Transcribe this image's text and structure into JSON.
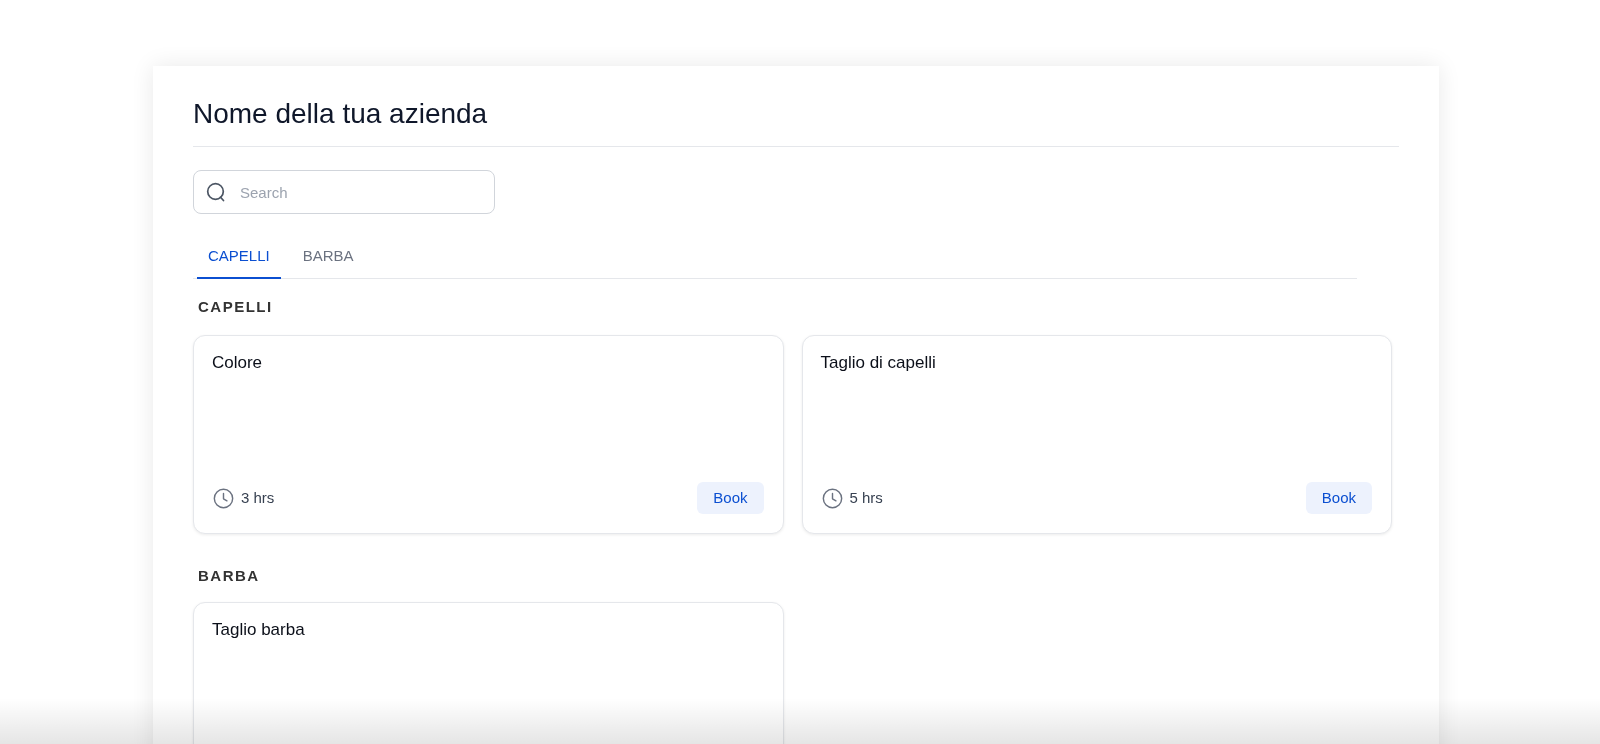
{
  "header": {
    "title": "Nome della tua azienda"
  },
  "search": {
    "placeholder": "Search"
  },
  "tabs": [
    {
      "label": "CAPELLI",
      "selected": true
    },
    {
      "label": "BARBA",
      "selected": false
    }
  ],
  "sections": [
    {
      "heading": "CAPELLI",
      "services": [
        {
          "name": "Colore",
          "duration": "3 hrs",
          "action": "Book"
        },
        {
          "name": "Taglio di capelli",
          "duration": "5 hrs",
          "action": "Book"
        }
      ]
    },
    {
      "heading": "BARBA",
      "services": [
        {
          "name": "Taglio barba"
        }
      ]
    }
  ]
}
